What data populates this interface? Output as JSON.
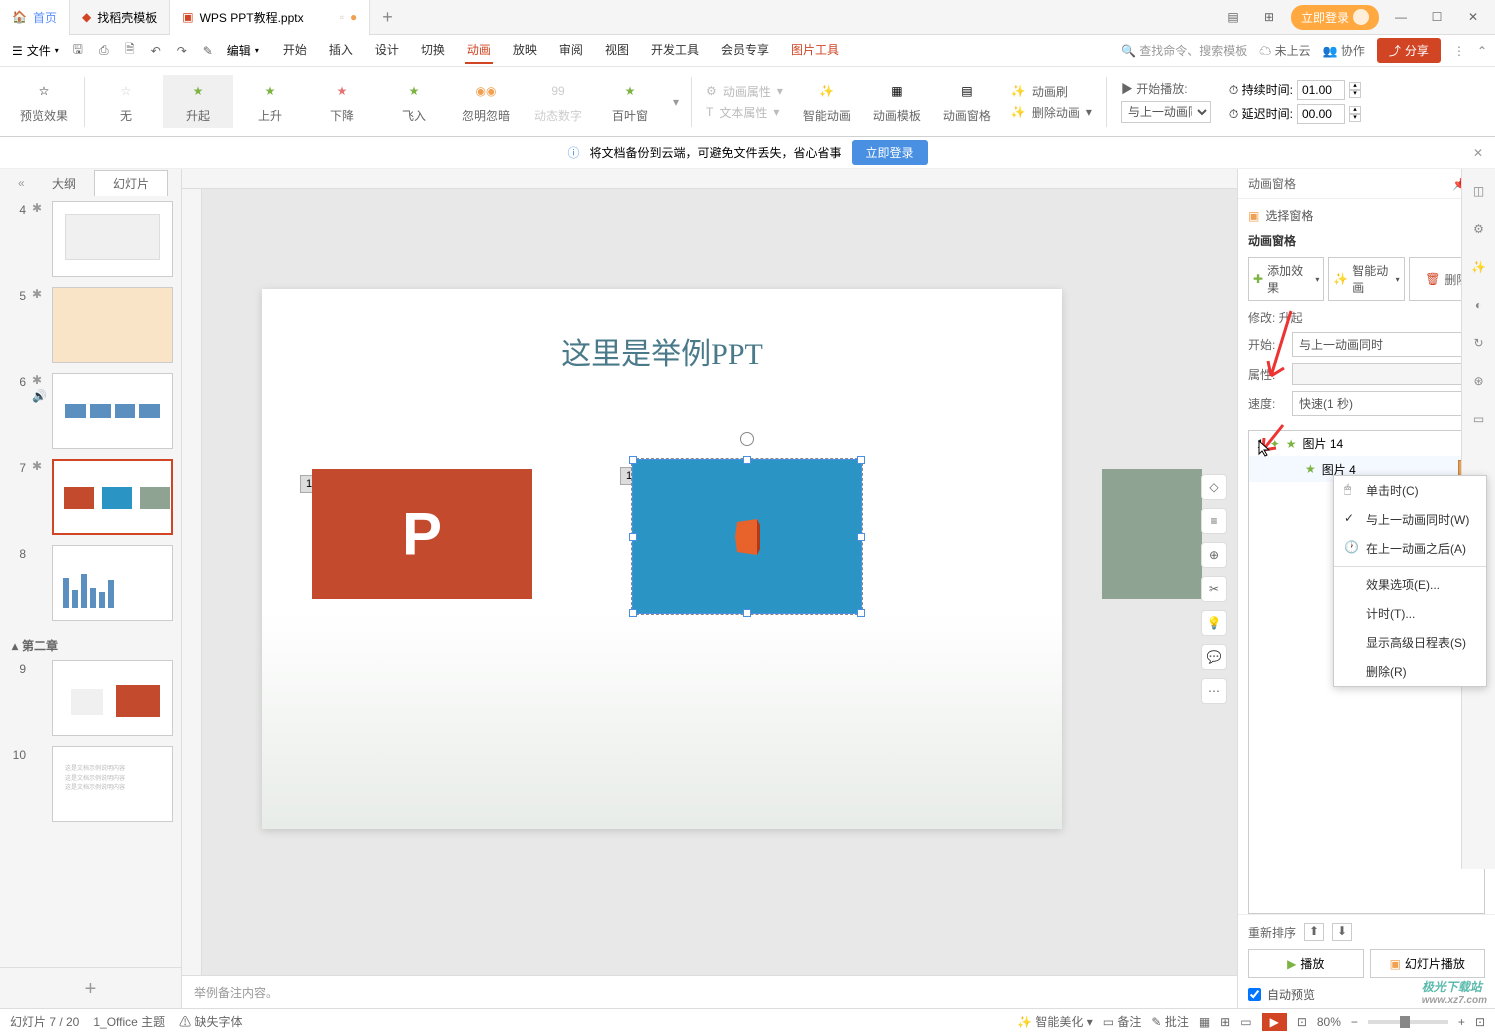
{
  "titleBar": {
    "homeTab": "首页",
    "templateTab": "找稻壳模板",
    "docTab": "WPS PPT教程.pptx",
    "loginBtn": "立即登录"
  },
  "menuBar": {
    "file": "文件",
    "edit": "编辑",
    "tabs": [
      "开始",
      "插入",
      "设计",
      "切换",
      "动画",
      "放映",
      "审阅",
      "视图",
      "开发工具",
      "会员专享",
      "图片工具"
    ],
    "activeTab": "动画",
    "searchPlaceholder": "查找命令、搜索模板",
    "notCloud": "未上云",
    "collab": "协作",
    "share": "分享"
  },
  "ribbon": {
    "preview": "预览效果",
    "anims": [
      "无",
      "升起",
      "上升",
      "下降",
      "飞入",
      "忽明忽暗",
      "动态数字",
      "百叶窗"
    ],
    "animProps": "动画属性",
    "textProps": "文本属性",
    "smartAnim": "智能动画",
    "animTemplate": "动画模板",
    "animPane": "动画窗格",
    "animBrush": "动画刷",
    "delAnim": "删除动画",
    "startPlay": "开始播放:",
    "startOption": "与上一动画同时",
    "duration": "持续时间:",
    "durationVal": "01.00",
    "delay": "延迟时间:",
    "delayVal": "00.00"
  },
  "banner": {
    "text": "将文档备份到云端，可避免文件丢失，省心省事",
    "btn": "立即登录"
  },
  "thumbPanel": {
    "outlineTab": "大纲",
    "slidesTab": "幻灯片",
    "section2": "第二章",
    "slideNums": [
      "4",
      "5",
      "6",
      "7",
      "8",
      "9",
      "10"
    ]
  },
  "slide": {
    "title": "这里是举例PPT",
    "tag1": "1",
    "tag2": "1"
  },
  "notes": "举例备注内容。",
  "animPanel": {
    "title": "动画窗格",
    "selectPane": "选择窗格",
    "paneTitle": "动画窗格",
    "addEffect": "添加效果",
    "smartAnim": "智能动画",
    "delete": "删除",
    "modify": "修改: 升起",
    "startLabel": "开始:",
    "startVal": "与上一动画同时",
    "propLabel": "属性:",
    "propVal": "",
    "speedLabel": "速度:",
    "speedVal": "快速(1 秒)",
    "item1Num": "1",
    "item1": "图片 14",
    "item2": "图片 4",
    "reorder": "重新排序",
    "play": "播放",
    "slideShow": "幻灯片播放",
    "autoPreview": "自动预览"
  },
  "contextMenu": {
    "onClick": "单击时(C)",
    "withPrev": "与上一动画同时(W)",
    "afterPrev": "在上一动画之后(A)",
    "effectOpts": "效果选项(E)...",
    "timing": "计时(T)...",
    "advTimeline": "显示高级日程表(S)",
    "remove": "删除(R)"
  },
  "statusBar": {
    "slideNum": "幻灯片 7 / 20",
    "theme": "1_Office 主题",
    "missingFont": "缺失字体",
    "beautify": "智能美化",
    "notes": "备注",
    "annotate": "批注",
    "zoom": "80%"
  },
  "watermark": {
    "main": "极光下载站",
    "sub": "www.xz7.com"
  }
}
